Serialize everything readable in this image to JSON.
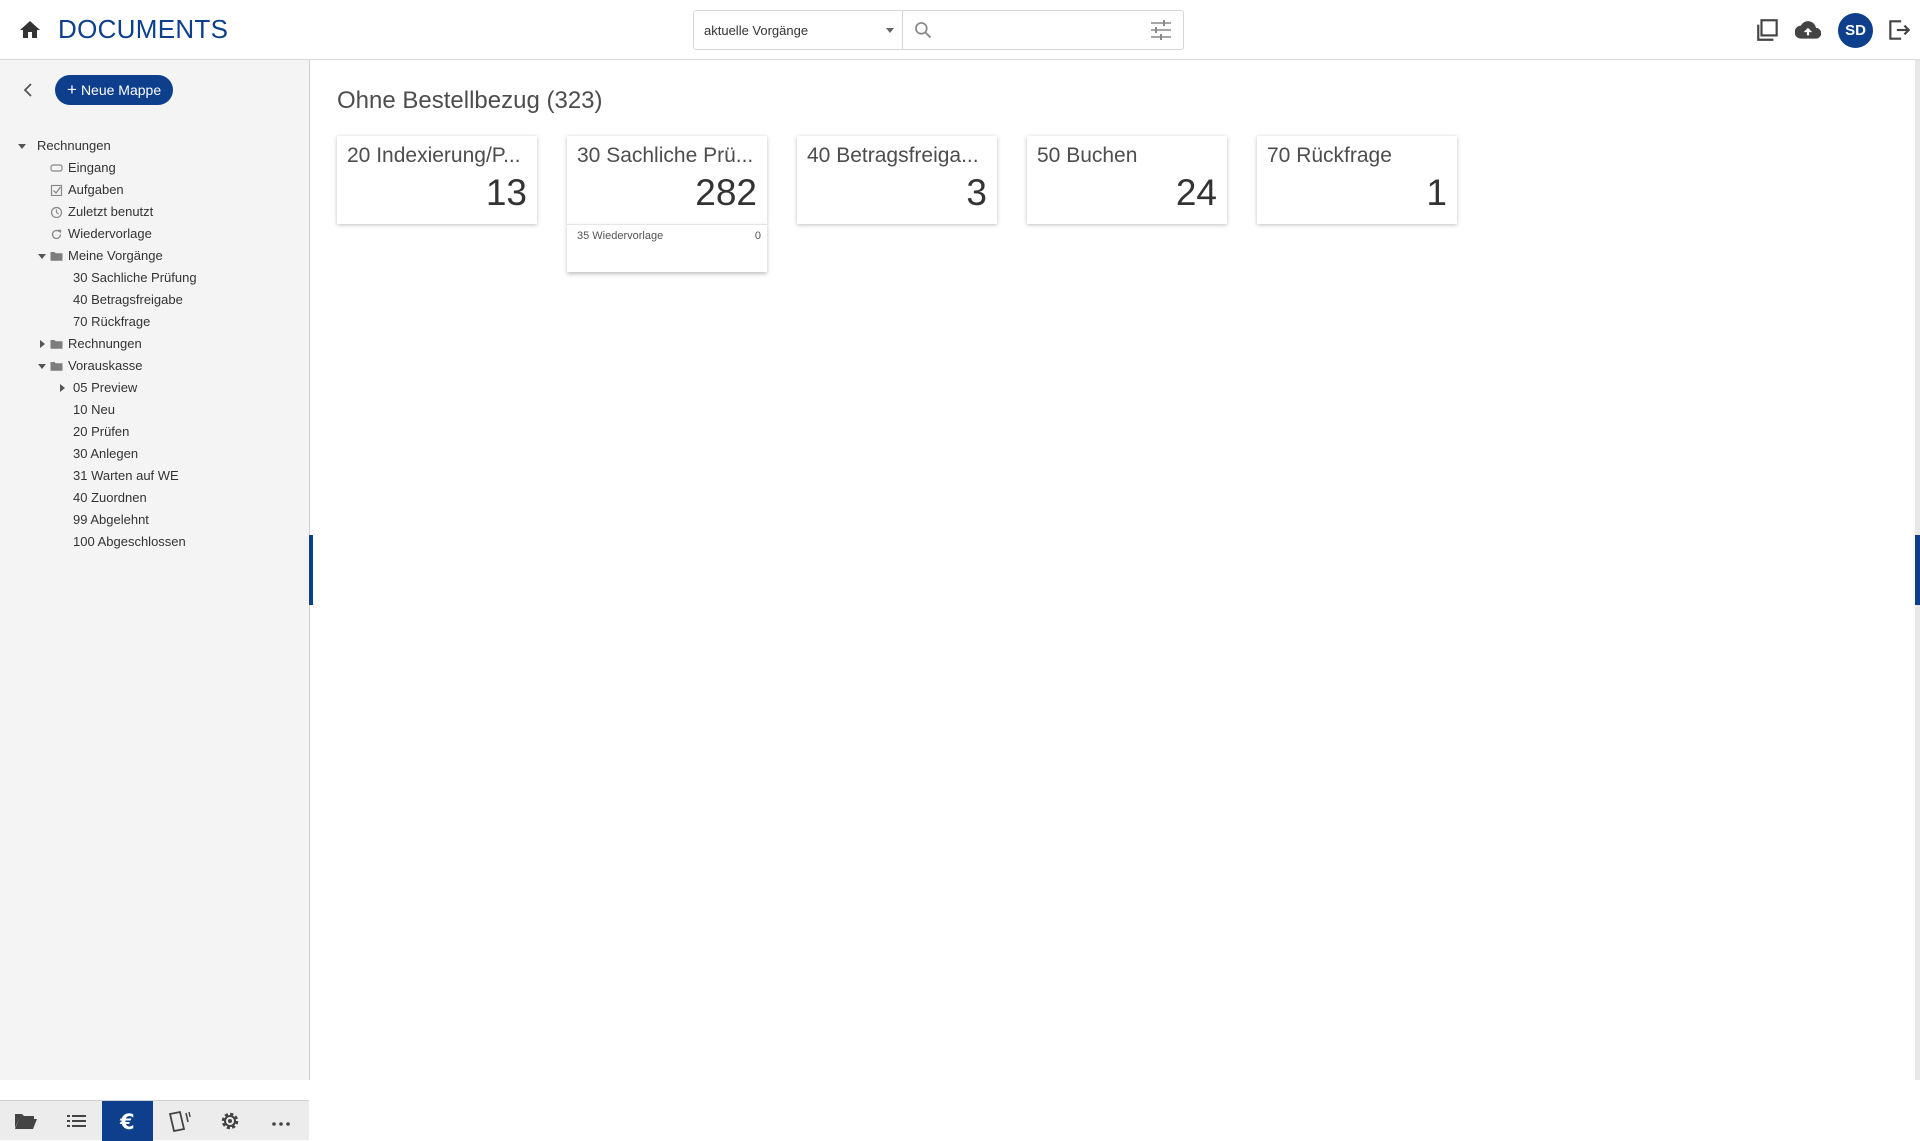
{
  "header": {
    "app_title": "DOCUMENTS",
    "scope_select": "aktuelle Vorgänge",
    "search_value": "",
    "avatar_initials": "SD",
    "accent_color": "#0d3f8c"
  },
  "sidebar": {
    "new_folder_button": "Neue Mappe",
    "tree": [
      {
        "label": "Rechnungen",
        "level": 0,
        "toggle": "expanded",
        "icon": ""
      },
      {
        "label": "Eingang",
        "level": 1,
        "toggle": "",
        "icon": "inbox-icon"
      },
      {
        "label": "Aufgaben",
        "level": 1,
        "toggle": "",
        "icon": "checkbox-icon"
      },
      {
        "label": "Zuletzt benutzt",
        "level": 1,
        "toggle": "",
        "icon": "clock-icon"
      },
      {
        "label": "Wiedervorlage",
        "level": 1,
        "toggle": "",
        "icon": "refresh-icon"
      },
      {
        "label": "Meine Vorgänge",
        "level": 1,
        "toggle": "expanded",
        "icon": "folder-icon"
      },
      {
        "label": "30 Sachliche Prüfung",
        "level": 2,
        "toggle": "",
        "icon": ""
      },
      {
        "label": "40 Betragsfreigabe",
        "level": 2,
        "toggle": "",
        "icon": ""
      },
      {
        "label": "70 Rückfrage",
        "level": 2,
        "toggle": "",
        "icon": ""
      },
      {
        "label": "Rechnungen",
        "level": 1,
        "toggle": "collapsed",
        "icon": "folder-icon"
      },
      {
        "label": "Vorauskasse",
        "level": 1,
        "toggle": "expanded",
        "icon": "folder-icon"
      },
      {
        "label": "05 Preview",
        "level": 2,
        "toggle": "collapsed",
        "icon": ""
      },
      {
        "label": "10 Neu",
        "level": 2,
        "toggle": "",
        "icon": ""
      },
      {
        "label": "20 Prüfen",
        "level": 2,
        "toggle": "",
        "icon": ""
      },
      {
        "label": "30 Anlegen",
        "level": 2,
        "toggle": "",
        "icon": ""
      },
      {
        "label": "31 Warten auf WE",
        "level": 2,
        "toggle": "",
        "icon": ""
      },
      {
        "label": "40 Zuordnen",
        "level": 2,
        "toggle": "",
        "icon": ""
      },
      {
        "label": "99 Abgelehnt",
        "level": 2,
        "toggle": "",
        "icon": ""
      },
      {
        "label": "100 Abgeschlossen",
        "level": 2,
        "toggle": "",
        "icon": ""
      }
    ],
    "bottom_tabs": [
      {
        "icon": "folder-open-icon",
        "active": false
      },
      {
        "icon": "list-icon",
        "active": false
      },
      {
        "icon": "euro-icon",
        "active": true
      },
      {
        "icon": "tag-icon",
        "active": false
      },
      {
        "icon": "gear-icon",
        "active": false
      },
      {
        "icon": "more-icon",
        "active": false
      }
    ]
  },
  "main": {
    "title": "Ohne Bestellbezug (323)",
    "tiles": [
      {
        "label": "20 Indexierung/P...",
        "count": "13"
      },
      {
        "label": "30 Sachliche Prü...",
        "count": "282"
      },
      {
        "label": "40 Betragsfreiga...",
        "count": "3"
      },
      {
        "label": "50 Buchen",
        "count": "24"
      },
      {
        "label": "70 Rückfrage",
        "count": "1"
      }
    ],
    "subtile": {
      "label": "35 Wiedervorlage",
      "count": "0"
    }
  }
}
